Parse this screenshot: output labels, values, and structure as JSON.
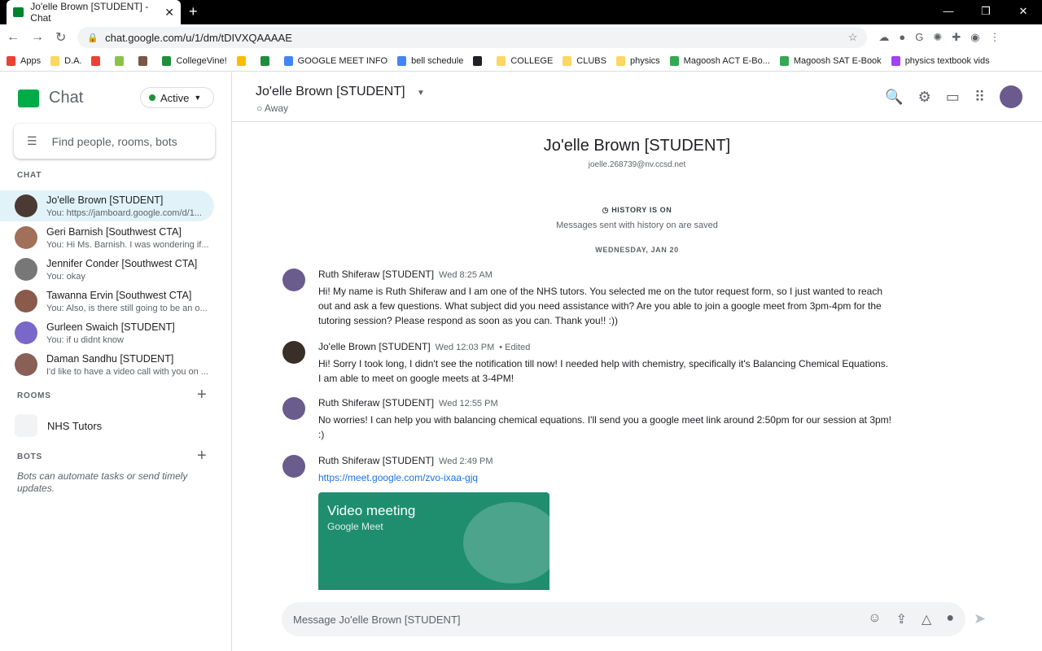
{
  "browser": {
    "tab_title": "Jo'elle Brown [STUDENT] - Chat",
    "url": "chat.google.com/u/1/dm/tDIVXQAAAAE",
    "bookmarks": [
      "Apps",
      "D.A.",
      "",
      "",
      "",
      "CollegeVine!",
      "",
      "",
      "GOOGLE MEET INFO",
      "bell schedule",
      "",
      "COLLEGE",
      "CLUBS",
      "physics",
      "Magoosh ACT E-Bo...",
      "Magoosh SAT E-Book",
      "physics textbook vids"
    ]
  },
  "sidebar": {
    "app_name": "Chat",
    "status": "Active",
    "search_placeholder": "Find people, rooms, bots",
    "chat_label": "CHAT",
    "rooms_label": "ROOMS",
    "bots_label": "BOTS",
    "dms": [
      {
        "name": "Jo'elle Brown [STUDENT]",
        "preview": "You: https://jamboard.google.com/d/1..."
      },
      {
        "name": "Geri Barnish [Southwest CTA]",
        "preview": "You: Hi Ms. Barnish. I was wondering if..."
      },
      {
        "name": "Jennifer Conder [Southwest CTA]",
        "preview": "You: okay"
      },
      {
        "name": "Tawanna Ervin [Southwest CTA]",
        "preview": "You: Also, is there still going to be an o..."
      },
      {
        "name": "Gurleen Swaich [STUDENT]",
        "preview": "You: if u didnt know"
      },
      {
        "name": "Daman Sandhu [STUDENT]",
        "preview": "I'd like to have a video call with you on ..."
      }
    ],
    "rooms": [
      {
        "name": "NHS Tutors"
      }
    ],
    "bots_hint": "Bots can automate tasks or send timely updates."
  },
  "header": {
    "title": "Jo'elle Brown [STUDENT]",
    "presence": "Away"
  },
  "conversation": {
    "name": "Jo'elle Brown [STUDENT]",
    "email": "joelle.268739@nv.ccsd.net",
    "history": "HISTORY IS ON",
    "history_sub": "Messages sent with history on are saved",
    "date": "WEDNESDAY, JAN 20",
    "messages": [
      {
        "sender": "Ruth Shiferaw [STUDENT]",
        "time": "Wed 8:25 AM",
        "text": "Hi! My name is Ruth Shiferaw and I am one of the NHS tutors. You selected me on the tutor request form, so I just wanted to reach out and ask a few questions. What subject did you need assistance with? Are you able to join a google meet from 3pm-4pm for the tutoring session? Please respond as soon as you can. Thank you!! :))"
      },
      {
        "sender": "Jo'elle Brown [STUDENT]",
        "time": "Wed 12:03 PM",
        "edited": "• Edited",
        "text": "Hi! Sorry I took long, I didn't see the notification till now! I needed help with chemistry, specifically it's Balancing Chemical Equations. I am able to meet on google meets at 3-4PM!"
      },
      {
        "sender": "Ruth Shiferaw [STUDENT]",
        "time": "Wed 12:55 PM",
        "text": "No worries! I can help you with balancing chemical equations. I'll send you a google meet link around 2:50pm for our session at 3pm! :)"
      },
      {
        "sender": "Ruth Shiferaw [STUDENT]",
        "time": "Wed 2:49 PM",
        "text": "https://meet.google.com/zvo-ixaa-gjq"
      }
    ],
    "card": {
      "title": "Video meeting",
      "subtitle": "Google Meet"
    }
  },
  "compose": {
    "placeholder": "Message Jo'elle Brown [STUDENT]"
  }
}
